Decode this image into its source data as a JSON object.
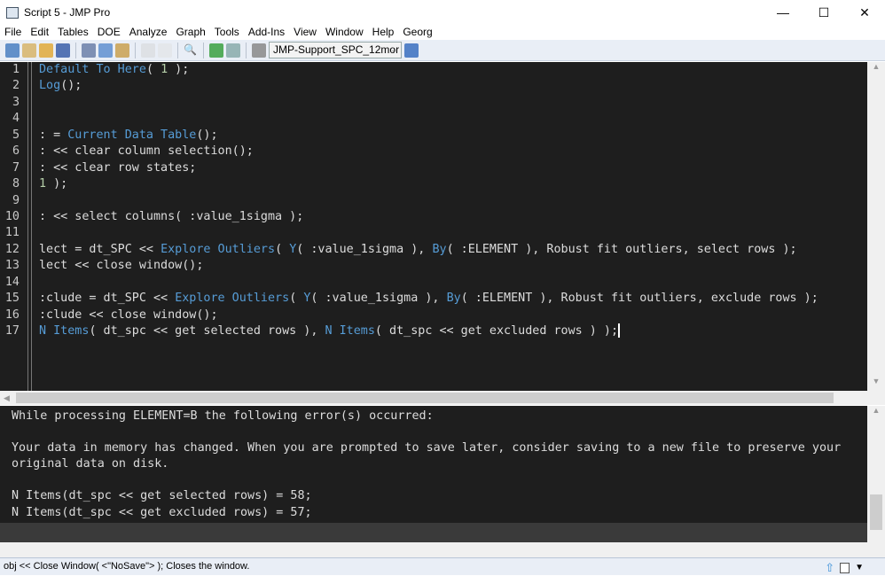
{
  "window": {
    "title": "Script 5 - JMP Pro",
    "minimize": "—",
    "maximize": "☐",
    "close": "✕"
  },
  "menu": [
    "File",
    "Edit",
    "Tables",
    "DOE",
    "Analyze",
    "Graph",
    "Tools",
    "Add-Ins",
    "View",
    "Window",
    "Help",
    "Georg"
  ],
  "toolbar": {
    "combo_value": "JMP-Support_SPC_12mor",
    "icons": [
      "new-script-icon",
      "new-table-icon",
      "open-icon",
      "save-icon",
      "cut-icon",
      "copy-icon",
      "paste-icon",
      "format-icon",
      "lock-icon",
      "search-icon",
      "run-script-icon",
      "debug-icon",
      "tools-icon",
      "window-list-icon"
    ]
  },
  "editor": {
    "line_numbers": [
      "1",
      "2",
      "3",
      "4",
      "5",
      "6",
      "7",
      "8",
      "9",
      "10",
      "11",
      "12",
      "13",
      "14",
      "15",
      "16",
      "17"
    ],
    "lines": [
      [
        [
          "Default To Here",
          "k"
        ],
        [
          "( ",
          "t"
        ],
        [
          "1",
          "n"
        ],
        [
          " );",
          "t"
        ]
      ],
      [
        [
          "Log",
          "k"
        ],
        [
          "();",
          "t"
        ]
      ],
      [],
      [],
      [
        [
          ": = ",
          "t"
        ],
        [
          "Current Data Table",
          "k"
        ],
        [
          "();",
          "t"
        ]
      ],
      [
        [
          ": << clear column selection();",
          "t"
        ]
      ],
      [
        [
          ": << clear row states;",
          "t"
        ]
      ],
      [
        [
          "1",
          "n"
        ],
        [
          " );",
          "t"
        ]
      ],
      [],
      [
        [
          ": << select columns( :value_1sigma );",
          "t"
        ]
      ],
      [],
      [
        [
          "lect = dt_SPC << ",
          "t"
        ],
        [
          "Explore Outliers",
          "k"
        ],
        [
          "( ",
          "t"
        ],
        [
          "Y",
          "k"
        ],
        [
          "( :value_1sigma ), ",
          "t"
        ],
        [
          "By",
          "k"
        ],
        [
          "( :ELEMENT ), Robust fit outliers, select rows );",
          "t"
        ]
      ],
      [
        [
          "lect << close window();",
          "t"
        ]
      ],
      [],
      [
        [
          ":clude = dt_SPC << ",
          "t"
        ],
        [
          "Explore Outliers",
          "k"
        ],
        [
          "( ",
          "t"
        ],
        [
          "Y",
          "k"
        ],
        [
          "( :value_1sigma ), ",
          "t"
        ],
        [
          "By",
          "k"
        ],
        [
          "( :ELEMENT ), Robust fit outliers, exclude rows );",
          "t"
        ]
      ],
      [
        [
          ":clude << close window();",
          "t"
        ]
      ],
      [
        [
          "N Items",
          "k"
        ],
        [
          "( dt_spc << get selected rows ), ",
          "t"
        ],
        [
          "N Items",
          "k"
        ],
        [
          "( dt_spc << get excluded rows ) );",
          "t"
        ]
      ]
    ]
  },
  "log": {
    "lines": [
      "While processing ELEMENT=B the following error(s) occurred:",
      "",
      "Your data in memory has changed. When you are prompted to save later, consider saving to a new file to preserve your",
      "original data on disk.",
      "",
      "N Items(dt_spc << get selected rows) = 58;",
      "N Items(dt_spc << get excluded rows) = 57;"
    ]
  },
  "status": {
    "text": "obj << Close Window( <\"NoSave\"> );  Closes the window."
  },
  "colors": {
    "editor_bg": "#1e1e1e",
    "keyword": "#569cd6",
    "number": "#b5cea8",
    "text": "#dcdcdc"
  }
}
